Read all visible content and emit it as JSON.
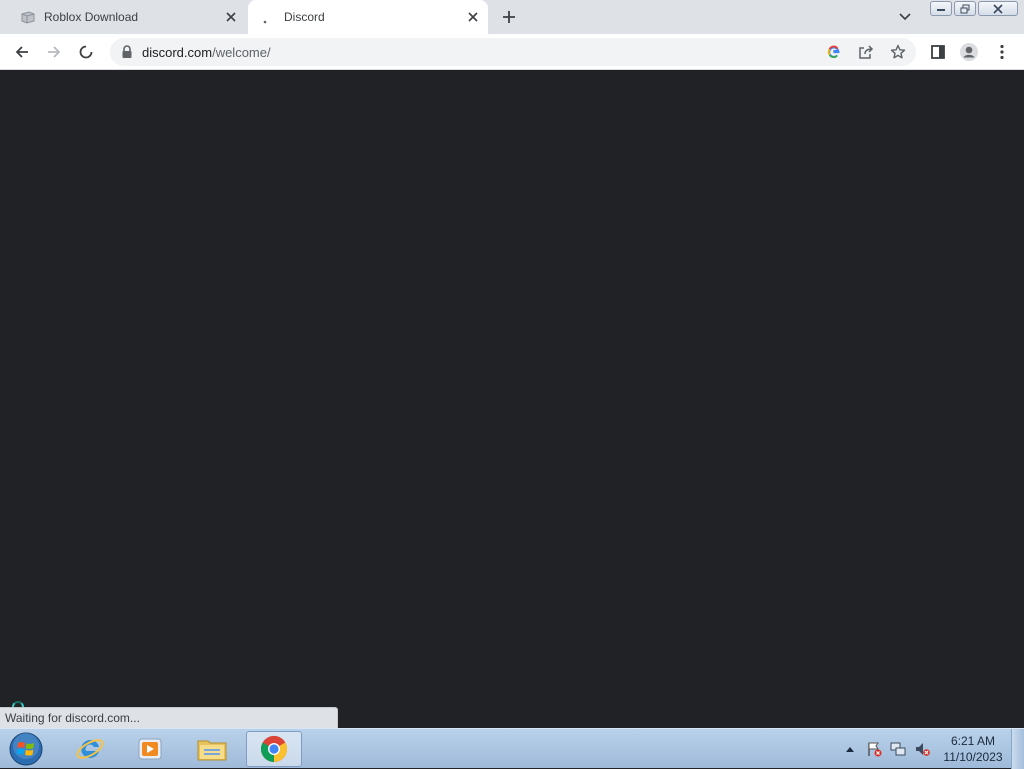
{
  "browser": {
    "tabs": [
      {
        "title": "Roblox Download",
        "active": false
      },
      {
        "title": "Discord",
        "active": true
      }
    ],
    "url": {
      "host": "discord.com",
      "path": "/welcome/"
    },
    "status_text": "Waiting for discord.com..."
  },
  "page": {
    "background": "#202225",
    "busy_color": "#3fc9c4"
  },
  "taskbar": {
    "apps": [
      "start-orb",
      "internet-explorer-icon",
      "media-player-icon",
      "file-explorer-icon",
      "chrome-icon"
    ],
    "clock": {
      "time": "6:21 AM",
      "date": "11/10/2023"
    }
  }
}
